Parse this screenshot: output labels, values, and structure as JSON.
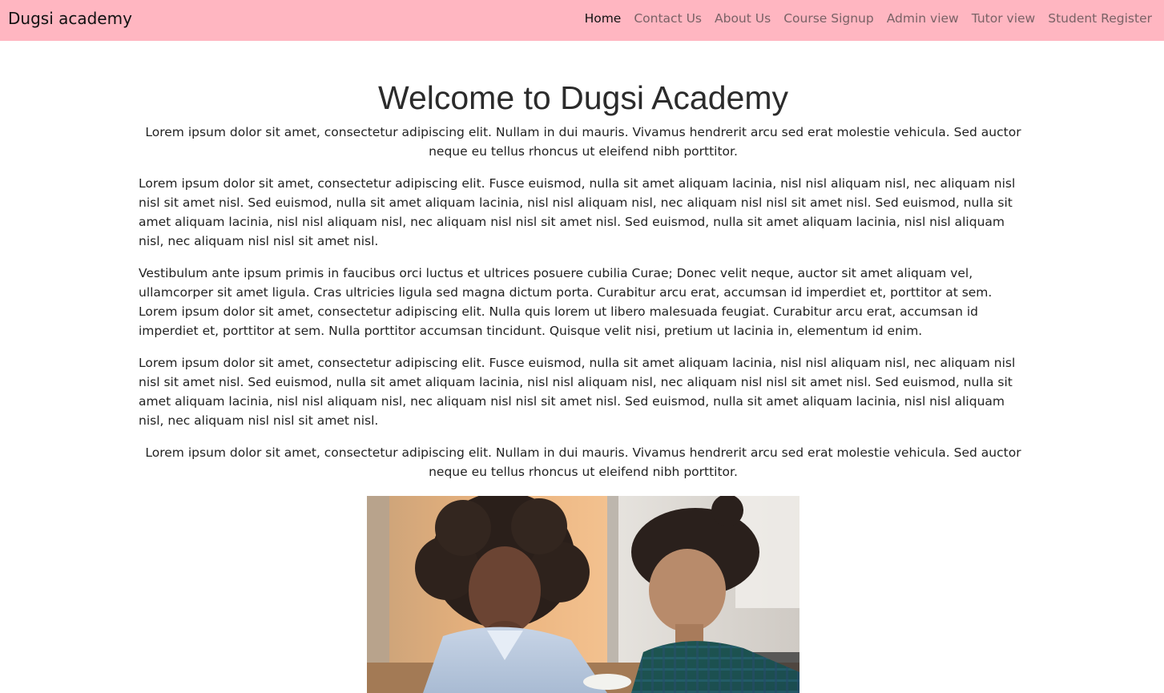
{
  "navbar": {
    "brand": "Dugsi academy",
    "links": [
      {
        "label": "Home",
        "active": true
      },
      {
        "label": "Contact Us",
        "active": false
      },
      {
        "label": "About Us",
        "active": false
      },
      {
        "label": "Course Signup",
        "active": false
      },
      {
        "label": "Admin view",
        "active": false
      },
      {
        "label": "Tutor view",
        "active": false
      },
      {
        "label": "Student Register",
        "active": false
      }
    ],
    "background_color": "#ffb6c1"
  },
  "main": {
    "title": "Welcome to Dugsi Academy",
    "paragraphs": [
      "Lorem ipsum dolor sit amet, consectetur adipiscing elit. Nullam in dui mauris. Vivamus hendrerit arcu sed erat molestie vehicula. Sed auctor neque eu tellus rhoncus ut eleifend nibh porttitor.",
      "Lorem ipsum dolor sit amet, consectetur adipiscing elit. Fusce euismod, nulla sit amet aliquam lacinia, nisl nisl aliquam nisl, nec aliquam nisl nisl sit amet nisl. Sed euismod, nulla sit amet aliquam lacinia, nisl nisl aliquam nisl, nec aliquam nisl nisl sit amet nisl. Sed euismod, nulla sit amet aliquam lacinia, nisl nisl aliquam nisl, nec aliquam nisl nisl sit amet nisl. Sed euismod, nulla sit amet aliquam lacinia, nisl nisl aliquam nisl, nec aliquam nisl nisl sit amet nisl.",
      "Vestibulum ante ipsum primis in faucibus orci luctus et ultrices posuere cubilia Curae; Donec velit neque, auctor sit amet aliquam vel, ullamcorper sit amet ligula. Cras ultricies ligula sed magna dictum porta. Curabitur arcu erat, accumsan id imperdiet et, porttitor at sem. Lorem ipsum dolor sit amet, consectetur adipiscing elit. Nulla quis lorem ut libero malesuada feugiat. Curabitur arcu erat, accumsan id imperdiet et, porttitor at sem. Nulla porttitor accumsan tincidunt. Quisque velit nisi, pretium ut lacinia in, elementum id enim.",
      "Lorem ipsum dolor sit amet, consectetur adipiscing elit. Fusce euismod, nulla sit amet aliquam lacinia, nisl nisl aliquam nisl, nec aliquam nisl nisl sit amet nisl. Sed euismod, nulla sit amet aliquam lacinia, nisl nisl aliquam nisl, nec aliquam nisl nisl sit amet nisl. Sed euismod, nulla sit amet aliquam lacinia, nisl nisl aliquam nisl, nec aliquam nisl nisl sit amet nisl. Sed euismod, nulla sit amet aliquam lacinia, nisl nisl aliquam nisl, nec aliquam nisl nisl sit amet nisl.",
      "Lorem ipsum dolor sit amet, consectetur adipiscing elit. Nullam in dui mauris. Vivamus hendrerit arcu sed erat molestie vehicula. Sed auctor neque eu tellus rhoncus ut eleifend nibh porttitor."
    ]
  }
}
